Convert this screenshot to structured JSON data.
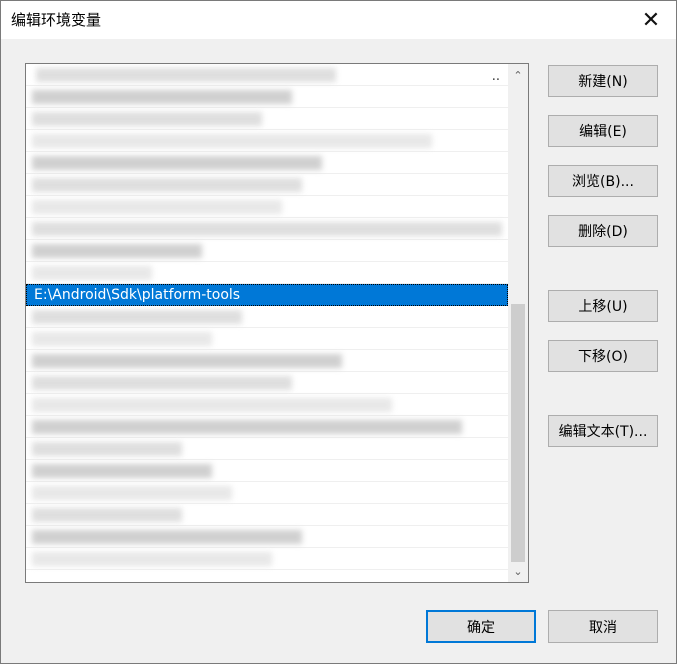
{
  "window": {
    "title": "编辑环境变量",
    "close_glyph": "✕"
  },
  "list": {
    "selected_text": "E:\\Android\\Sdk\\platform-tools",
    "first_row_suffix": ".."
  },
  "scrollbar": {
    "up_glyph": "⌃",
    "down_glyph": "⌄"
  },
  "buttons": {
    "new": "新建(N)",
    "edit": "编辑(E)",
    "browse": "浏览(B)...",
    "delete": "删除(D)",
    "move_up": "上移(U)",
    "move_down": "下移(O)",
    "edit_text": "编辑文本(T)...",
    "ok": "确定",
    "cancel": "取消"
  },
  "colors": {
    "selection": "#0078d7",
    "dialog_bg": "#f0f0f0",
    "button_bg": "#e1e1e1"
  }
}
